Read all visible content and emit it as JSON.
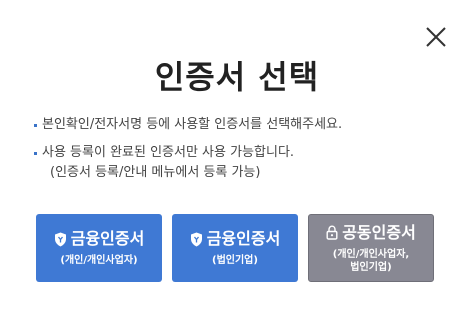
{
  "dialog": {
    "title": "인증서 선택",
    "notice": {
      "line1": "본인확인/전자서명 등에 사용할 인증서를 선택해주세요.",
      "line2": "사용 등록이 완료된 인증서만 사용 가능합니다.",
      "line2_sub": "(인증서 등록/안내 메뉴에서 등록 가능)"
    },
    "buttons": [
      {
        "label": "금융인증서",
        "sub": "(개인/개인사업자)",
        "icon": "shield-icon"
      },
      {
        "label": "금융인증서",
        "sub": "(법인기업)",
        "icon": "shield-icon"
      },
      {
        "label": "공동인증서",
        "sub": "(개인/개인사업자,\n법인기업)",
        "icon": "lock-icon"
      }
    ],
    "close_icon": "close-icon"
  },
  "colors": {
    "finance_button": "#3f79d4",
    "joint_button": "#888893",
    "bullet": "#3a73c8"
  }
}
